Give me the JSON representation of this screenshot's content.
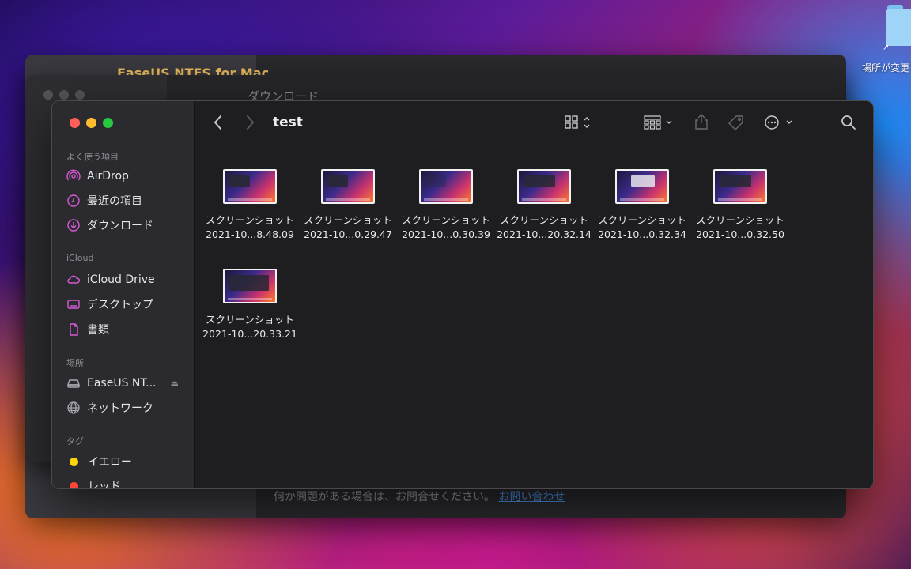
{
  "desktop": {
    "folder_label": "場所が変更"
  },
  "back_windows": {
    "easeus_title": "EaseUS NTFS for Mac",
    "help_text": "何か問題がある場合は、お問合せください。",
    "help_link": "お問い合わせ",
    "downloads_title": "ダウンロード"
  },
  "finder": {
    "title": "test",
    "sidebar": {
      "favorites_header": "よく使う項目",
      "favorites": [
        {
          "label": "AirDrop",
          "icon": "airdrop-icon"
        },
        {
          "label": "最近の項目",
          "icon": "clock-icon"
        },
        {
          "label": "ダウンロード",
          "icon": "download-icon"
        }
      ],
      "icloud_header": "iCloud",
      "icloud": [
        {
          "label": "iCloud Drive",
          "icon": "cloud-icon"
        },
        {
          "label": "デスクトップ",
          "icon": "desktop-icon"
        },
        {
          "label": "書類",
          "icon": "document-icon"
        }
      ],
      "locations_header": "場所",
      "locations": [
        {
          "label": "EaseUS NT...",
          "icon": "drive-icon"
        },
        {
          "label": "ネットワーク",
          "icon": "globe-icon"
        }
      ],
      "tags_header": "タグ",
      "tags": [
        {
          "label": "イエロー",
          "color": "#ffd60a"
        },
        {
          "label": "レッド",
          "color": "#ff453a"
        }
      ]
    },
    "files": [
      {
        "line1": "スクリーンショット",
        "line2": "2021-10...8.48.09"
      },
      {
        "line1": "スクリーンショット",
        "line2": "2021-10...0.29.47"
      },
      {
        "line1": "スクリーンショット",
        "line2": "2021-10...0.30.39"
      },
      {
        "line1": "スクリーンショット",
        "line2": "2021-10...20.32.14"
      },
      {
        "line1": "スクリーンショット",
        "line2": "2021-10...0.32.34"
      },
      {
        "line1": "スクリーンショット",
        "line2": "2021-10...0.32.50"
      },
      {
        "line1": "スクリーンショット",
        "line2": "2021-10...20.33.21"
      }
    ]
  }
}
